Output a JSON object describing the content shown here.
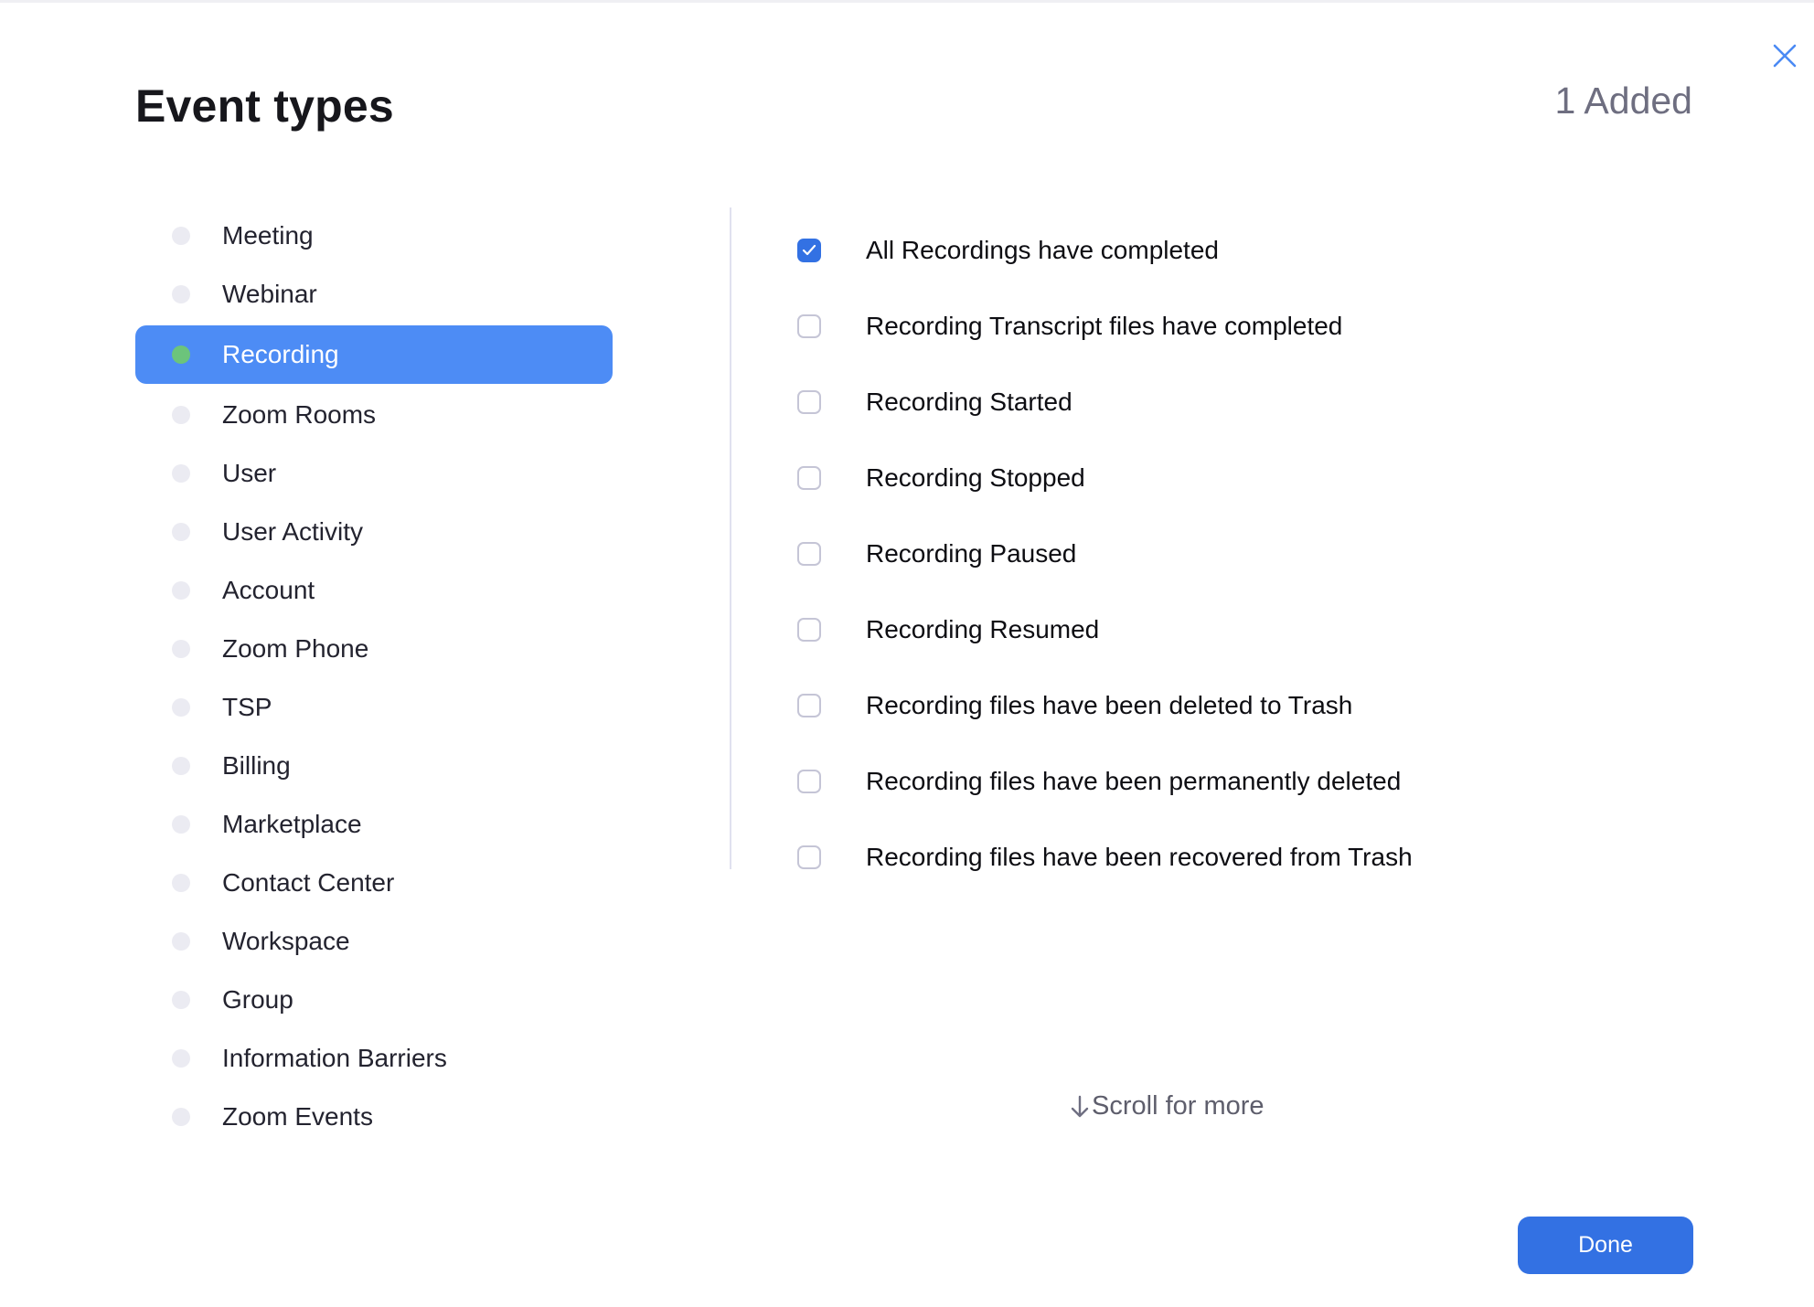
{
  "dialog": {
    "title": "Event types",
    "added_count": "1 Added",
    "close_icon": "close-icon"
  },
  "categories": [
    {
      "label": "Meeting",
      "active": false
    },
    {
      "label": "Webinar",
      "active": false
    },
    {
      "label": "Recording",
      "active": true
    },
    {
      "label": "Zoom Rooms",
      "active": false
    },
    {
      "label": "User",
      "active": false
    },
    {
      "label": "User Activity",
      "active": false
    },
    {
      "label": "Account",
      "active": false
    },
    {
      "label": "Zoom Phone",
      "active": false
    },
    {
      "label": "TSP",
      "active": false
    },
    {
      "label": "Billing",
      "active": false
    },
    {
      "label": "Marketplace",
      "active": false
    },
    {
      "label": "Contact Center",
      "active": false
    },
    {
      "label": "Workspace",
      "active": false
    },
    {
      "label": "Group",
      "active": false
    },
    {
      "label": "Information Barriers",
      "active": false
    },
    {
      "label": "Zoom Events",
      "active": false
    }
  ],
  "events": [
    {
      "label": "All Recordings have completed",
      "checked": true
    },
    {
      "label": "Recording Transcript files have completed",
      "checked": false
    },
    {
      "label": "Recording Started",
      "checked": false
    },
    {
      "label": "Recording Stopped",
      "checked": false
    },
    {
      "label": "Recording Paused",
      "checked": false
    },
    {
      "label": "Recording Resumed",
      "checked": false
    },
    {
      "label": "Recording files have been deleted to Trash",
      "checked": false
    },
    {
      "label": "Recording files have been permanently deleted",
      "checked": false
    },
    {
      "label": "Recording files have been recovered from Trash",
      "checked": false
    }
  ],
  "scroll_hint": {
    "arrow": "↓",
    "text": "Scroll for more"
  },
  "footer": {
    "done_label": "Done"
  },
  "colors": {
    "accent": "#3371e3",
    "active_row": "#4d8cf5",
    "active_dot": "#6cc47b",
    "inactive_dot": "#ebebf2",
    "close_icon": "#4a8af4"
  }
}
